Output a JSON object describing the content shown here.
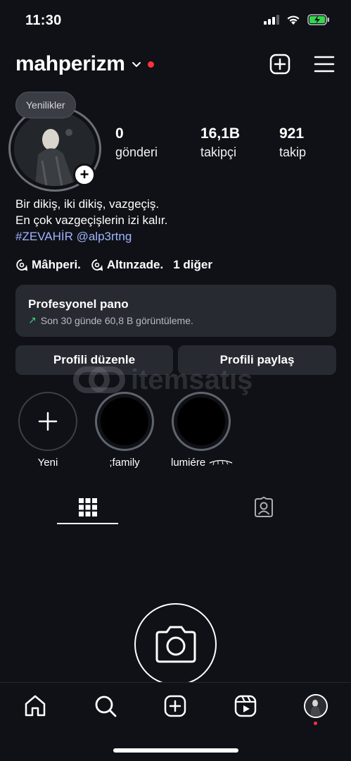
{
  "status_bar": {
    "time": "11:30"
  },
  "header": {
    "username": "mahperizm",
    "notification_color": "#ff3040"
  },
  "profile": {
    "news_bubble": "Yenilikler",
    "stats": [
      {
        "value": "0",
        "label": "gönderi"
      },
      {
        "value": "16,1B",
        "label": "takipçi"
      },
      {
        "value": "921",
        "label": "takip"
      }
    ],
    "bio_lines": [
      "Bir dikiş, iki dikiş, vazgeçiş.",
      "En çok vazgeçişlerin izi kalır."
    ],
    "bio_tags": "#ZEVAHİR @alp3rtng",
    "threads": [
      {
        "label": "Mâhperi."
      },
      {
        "label": "Altınzade."
      }
    ],
    "threads_more": "1 diğer"
  },
  "pro_panel": {
    "title": "Profesyonel pano",
    "subtitle": "Son 30 günde 60,8 B görüntüleme."
  },
  "buttons": {
    "edit": "Profili düzenle",
    "share": "Profili paylaş"
  },
  "watermark": "itemsatış",
  "highlights": [
    {
      "label": "Yeni"
    },
    {
      "label": ";family"
    },
    {
      "label": "lumiére"
    }
  ],
  "tabs": [
    "grid",
    "tagged"
  ],
  "bottom_nav": [
    "home",
    "search",
    "create",
    "reels",
    "profile"
  ]
}
